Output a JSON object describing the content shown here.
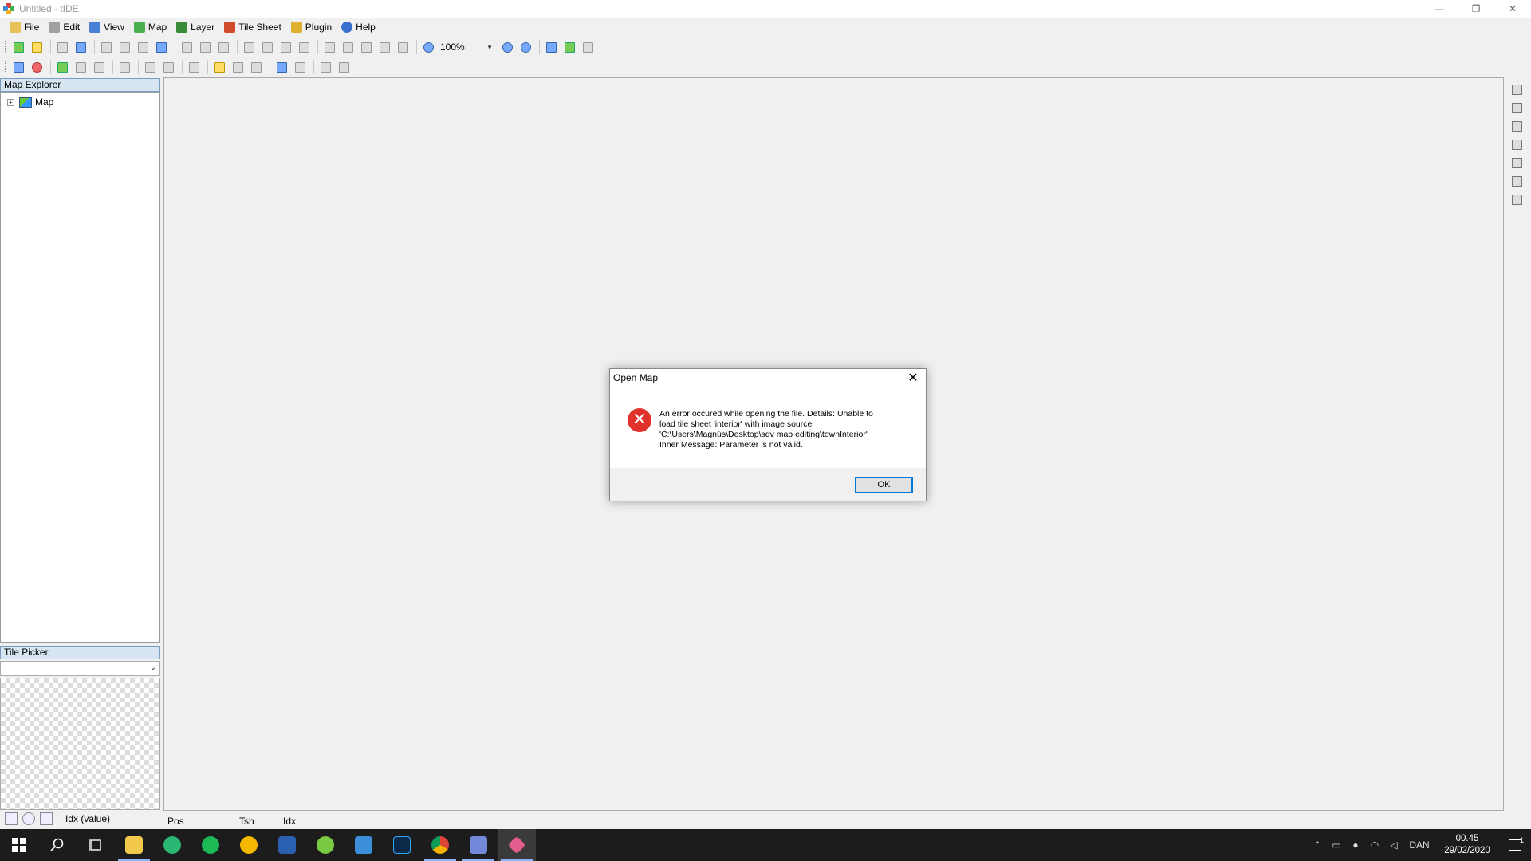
{
  "window": {
    "title": "Untitled - tIDE",
    "controls": [
      "—",
      "❐",
      "✕"
    ]
  },
  "menu": [
    {
      "label": "File",
      "color": "#e8c35a"
    },
    {
      "label": "Edit",
      "color": "#a0a0a0"
    },
    {
      "label": "View",
      "color": "#4a7fd6"
    },
    {
      "label": "Map",
      "color": "#4caf50"
    },
    {
      "label": "Layer",
      "color": "#3a8a3a"
    },
    {
      "label": "Tile Sheet",
      "color": "#d04a2a"
    },
    {
      "label": "Plugin",
      "color": "#e0b030"
    },
    {
      "label": "Help",
      "color": "#3a6fd0"
    }
  ],
  "toolbar": {
    "zoom_value": "100%"
  },
  "map_explorer": {
    "title": "Map Explorer",
    "root_label": "Map",
    "expander": "+"
  },
  "tile_picker": {
    "title": "Tile Picker",
    "footer_label": "Idx  (value)"
  },
  "status": {
    "pos": "Pos",
    "tsh": "Tsh",
    "idx": "Idx"
  },
  "dialog": {
    "title": "Open Map",
    "close": "✕",
    "icon": "✕",
    "lines": [
      "An error occured while opening the file. Details: Unable to",
      "load tile sheet 'interior' with image source",
      "'C:\\Users\\Magnús\\Desktop\\sdv map editing\\townInterior'",
      "Inner Message: Parameter is not valid."
    ],
    "ok_label": "OK"
  },
  "taskbar": {
    "apps": [
      {
        "name": "file-explorer",
        "color": "#f2c94c"
      },
      {
        "name": "app-green",
        "color": "#2bb673"
      },
      {
        "name": "spotify",
        "color": "#1db954"
      },
      {
        "name": "app-yellow",
        "color": "#f5b700"
      },
      {
        "name": "app-translate",
        "color": "#2b5fb0"
      },
      {
        "name": "app-vortex",
        "color": "#7ac943"
      },
      {
        "name": "app-bird",
        "color": "#3b8fd8"
      },
      {
        "name": "photoshop",
        "color": "#0b2a4a"
      },
      {
        "name": "chrome",
        "color": "#db4437"
      },
      {
        "name": "discord",
        "color": "#7289da"
      },
      {
        "name": "tide",
        "color": "#e35e8e"
      }
    ],
    "language": "DAN",
    "time": "00.45",
    "date": "29/02/2020",
    "notifications": "1"
  }
}
